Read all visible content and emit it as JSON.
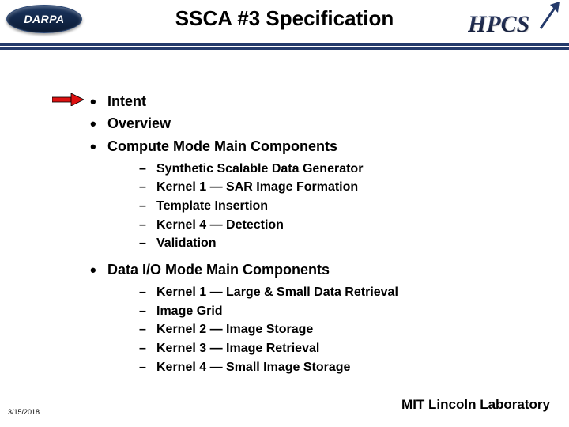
{
  "header": {
    "title": "SSCA #3 Specification",
    "leftLogoAlt": "DARPA",
    "rightLogoAlt": "HPCS"
  },
  "bullets": [
    {
      "text": "Intent",
      "sub": []
    },
    {
      "text": "Overview",
      "sub": []
    },
    {
      "text": "Compute Mode Main Components",
      "sub": [
        "Synthetic Scalable Data Generator",
        "Kernel 1 — SAR Image Formation",
        "Template Insertion",
        "Kernel 4 — Detection",
        "Validation"
      ]
    },
    {
      "text": "Data I/O Mode Main Components",
      "sub": [
        "Kernel 1 — Large & Small Data Retrieval",
        "Image Grid",
        "Kernel 2 — Image Storage",
        "Kernel 3 — Image Retrieval",
        "Kernel 4 — Small Image Storage"
      ]
    }
  ],
  "footer": {
    "date": "3/15/2018",
    "lab": "MIT Lincoln Laboratory"
  }
}
